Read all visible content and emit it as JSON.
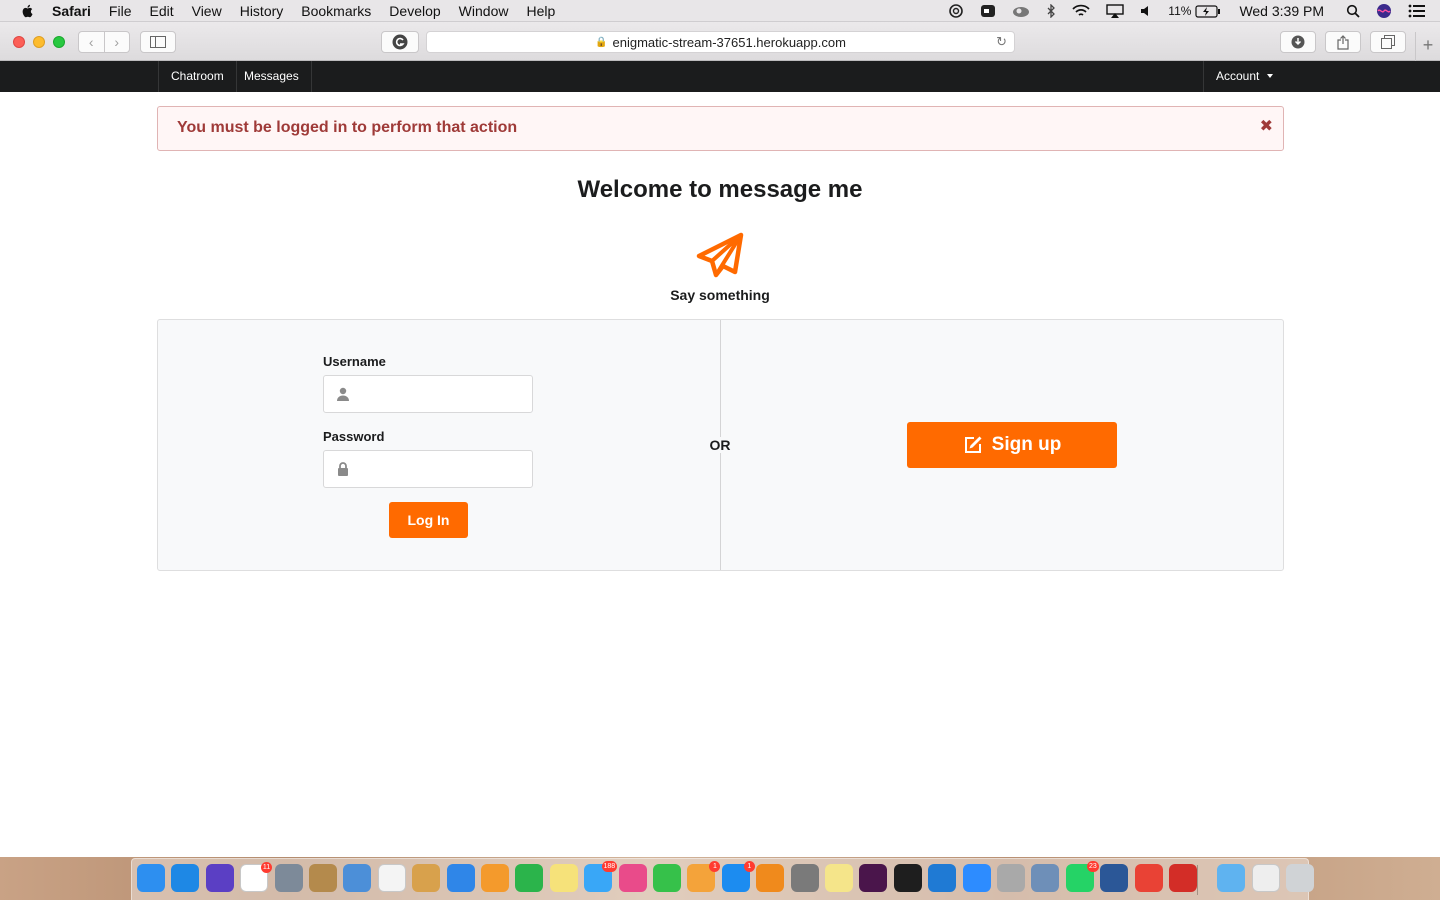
{
  "menubar": {
    "app_name": "Safari",
    "items": [
      "File",
      "Edit",
      "View",
      "History",
      "Bookmarks",
      "Develop",
      "Window",
      "Help"
    ],
    "battery": "11%",
    "clock": "Wed 3:39 PM"
  },
  "browser": {
    "url": "enigmatic-stream-37651.herokuapp.com"
  },
  "nav": {
    "chatroom": "Chatroom",
    "messages": "Messages",
    "account": "Account"
  },
  "alert": {
    "message": "You must be logged in to perform that action",
    "close_glyph": "✖",
    "color": "#9f3a38"
  },
  "main": {
    "title": "Welcome to message me",
    "icon": "paper-plane-icon",
    "subtitle": "Say something"
  },
  "login_form": {
    "username_label": "Username",
    "username_value": "",
    "password_label": "Password",
    "password_value": "",
    "submit_label": "Log In"
  },
  "divider_text": "OR",
  "signup": {
    "label": "Sign up",
    "icon": "edit-icon"
  },
  "dock": {
    "apps": [
      {
        "name": "finder",
        "color": "#2d8ff0",
        "badge": ""
      },
      {
        "name": "safari",
        "color": "#1e88e5",
        "badge": ""
      },
      {
        "name": "siri",
        "color": "#5b3fc4",
        "badge": ""
      },
      {
        "name": "calendar",
        "color": "#ffffff",
        "badge": "11"
      },
      {
        "name": "launchpad",
        "color": "#7d8a99",
        "badge": ""
      },
      {
        "name": "notes-book",
        "color": "#b48a4c",
        "badge": ""
      },
      {
        "name": "preview",
        "color": "#4c8fd8",
        "badge": ""
      },
      {
        "name": "reminders",
        "color": "#f4f4f4",
        "badge": ""
      },
      {
        "name": "photo-booth",
        "color": "#d8a14c",
        "badge": ""
      },
      {
        "name": "keynote",
        "color": "#2f86e8",
        "badge": ""
      },
      {
        "name": "pages",
        "color": "#f49a2c",
        "badge": ""
      },
      {
        "name": "numbers",
        "color": "#2bb44b",
        "badge": ""
      },
      {
        "name": "notes",
        "color": "#f6e27a",
        "badge": ""
      },
      {
        "name": "messages",
        "color": "#39a7f7",
        "badge": "188"
      },
      {
        "name": "itunes",
        "color": "#e94b8a",
        "badge": ""
      },
      {
        "name": "facetime",
        "color": "#36c14a",
        "badge": ""
      },
      {
        "name": "photos",
        "color": "#f4a33a",
        "badge": "1"
      },
      {
        "name": "app-store",
        "color": "#1c8cf0",
        "badge": "1"
      },
      {
        "name": "books",
        "color": "#f08a1c",
        "badge": ""
      },
      {
        "name": "system-preferences",
        "color": "#7a7a7a",
        "badge": ""
      },
      {
        "name": "stickies",
        "color": "#f5e58a",
        "badge": ""
      },
      {
        "name": "slack",
        "color": "#4a154b",
        "badge": ""
      },
      {
        "name": "terminal",
        "color": "#1e1e1e",
        "badge": ""
      },
      {
        "name": "vscode",
        "color": "#1f7ad4",
        "badge": ""
      },
      {
        "name": "zoom",
        "color": "#2d8cff",
        "badge": ""
      },
      {
        "name": "xcode-tool",
        "color": "#a9a9a9",
        "badge": ""
      },
      {
        "name": "image-capture",
        "color": "#6e8fb8",
        "badge": ""
      },
      {
        "name": "whatsapp",
        "color": "#25d366",
        "badge": "23"
      },
      {
        "name": "word",
        "color": "#2b5797",
        "badge": ""
      },
      {
        "name": "chrome",
        "color": "#e94235",
        "badge": ""
      },
      {
        "name": "lastpass",
        "color": "#d32d27",
        "badge": ""
      },
      {
        "name": "folder",
        "color": "#5fb3f0",
        "badge": ""
      },
      {
        "name": "downloads",
        "color": "#eeeeee",
        "badge": ""
      },
      {
        "name": "trash",
        "color": "#d0d3d6",
        "badge": ""
      }
    ]
  },
  "colors": {
    "accent": "#ff6a00",
    "navbar": "#1b1c1d",
    "segment_bg": "#f8f9fa"
  }
}
